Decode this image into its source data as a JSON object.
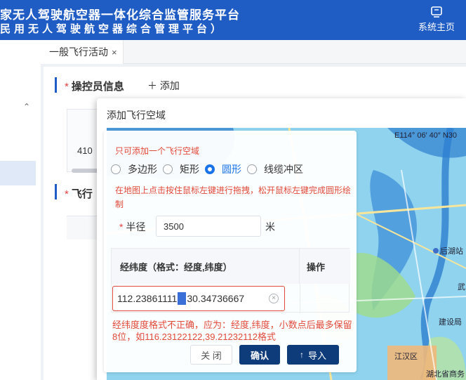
{
  "header": {
    "title_line1": "家无人驾驶航空器一体化综合监管服务平台",
    "title_line2": "民用无人驾驶航空器综合管理平台）",
    "home_label": "系统主页",
    "home_icon": "home-screen-icon"
  },
  "tabs": [
    {
      "label": "一般飞行活动",
      "close": "×"
    }
  ],
  "background_page": {
    "section1_title": "操控员信息",
    "section2_title": "飞行",
    "add_label": "添加",
    "required_mark": "*",
    "table_cell": "410"
  },
  "modal": {
    "title": "添加飞行空域",
    "warning_top": "只可添加一个飞行空域",
    "shapes": [
      {
        "label": "多边形",
        "selected": false
      },
      {
        "label": "矩形",
        "selected": false
      },
      {
        "label": "圆形",
        "selected": true
      },
      {
        "label": "线缆冲区",
        "selected": false
      }
    ],
    "hint": "在地图上点击按住鼠标左键进行拖拽，松开鼠标左键完成圆形绘制",
    "radius_label": "半径",
    "radius_value": "3500",
    "radius_unit": "米",
    "table_header_coord": "经纬度（格式：经度,纬度）",
    "table_header_action": "操作",
    "coord_before": "112.23861111",
    "coord_after": "30.34736667",
    "error_text": "经纬度度格式不正确，应为：经度,纬度，小数点后最多保留8位，如116.23122122,39.21232112格式",
    "btn_close": "关 闭",
    "btn_confirm": "确认",
    "btn_import": "导入",
    "accent_color": "#1a73e8",
    "error_color": "#e04a3a"
  },
  "map": {
    "coord_label": "E114° 06′ 40″  N30",
    "labels": [
      "后湖站",
      "武",
      "建设局",
      "江汉区",
      "湖北省商务"
    ]
  }
}
